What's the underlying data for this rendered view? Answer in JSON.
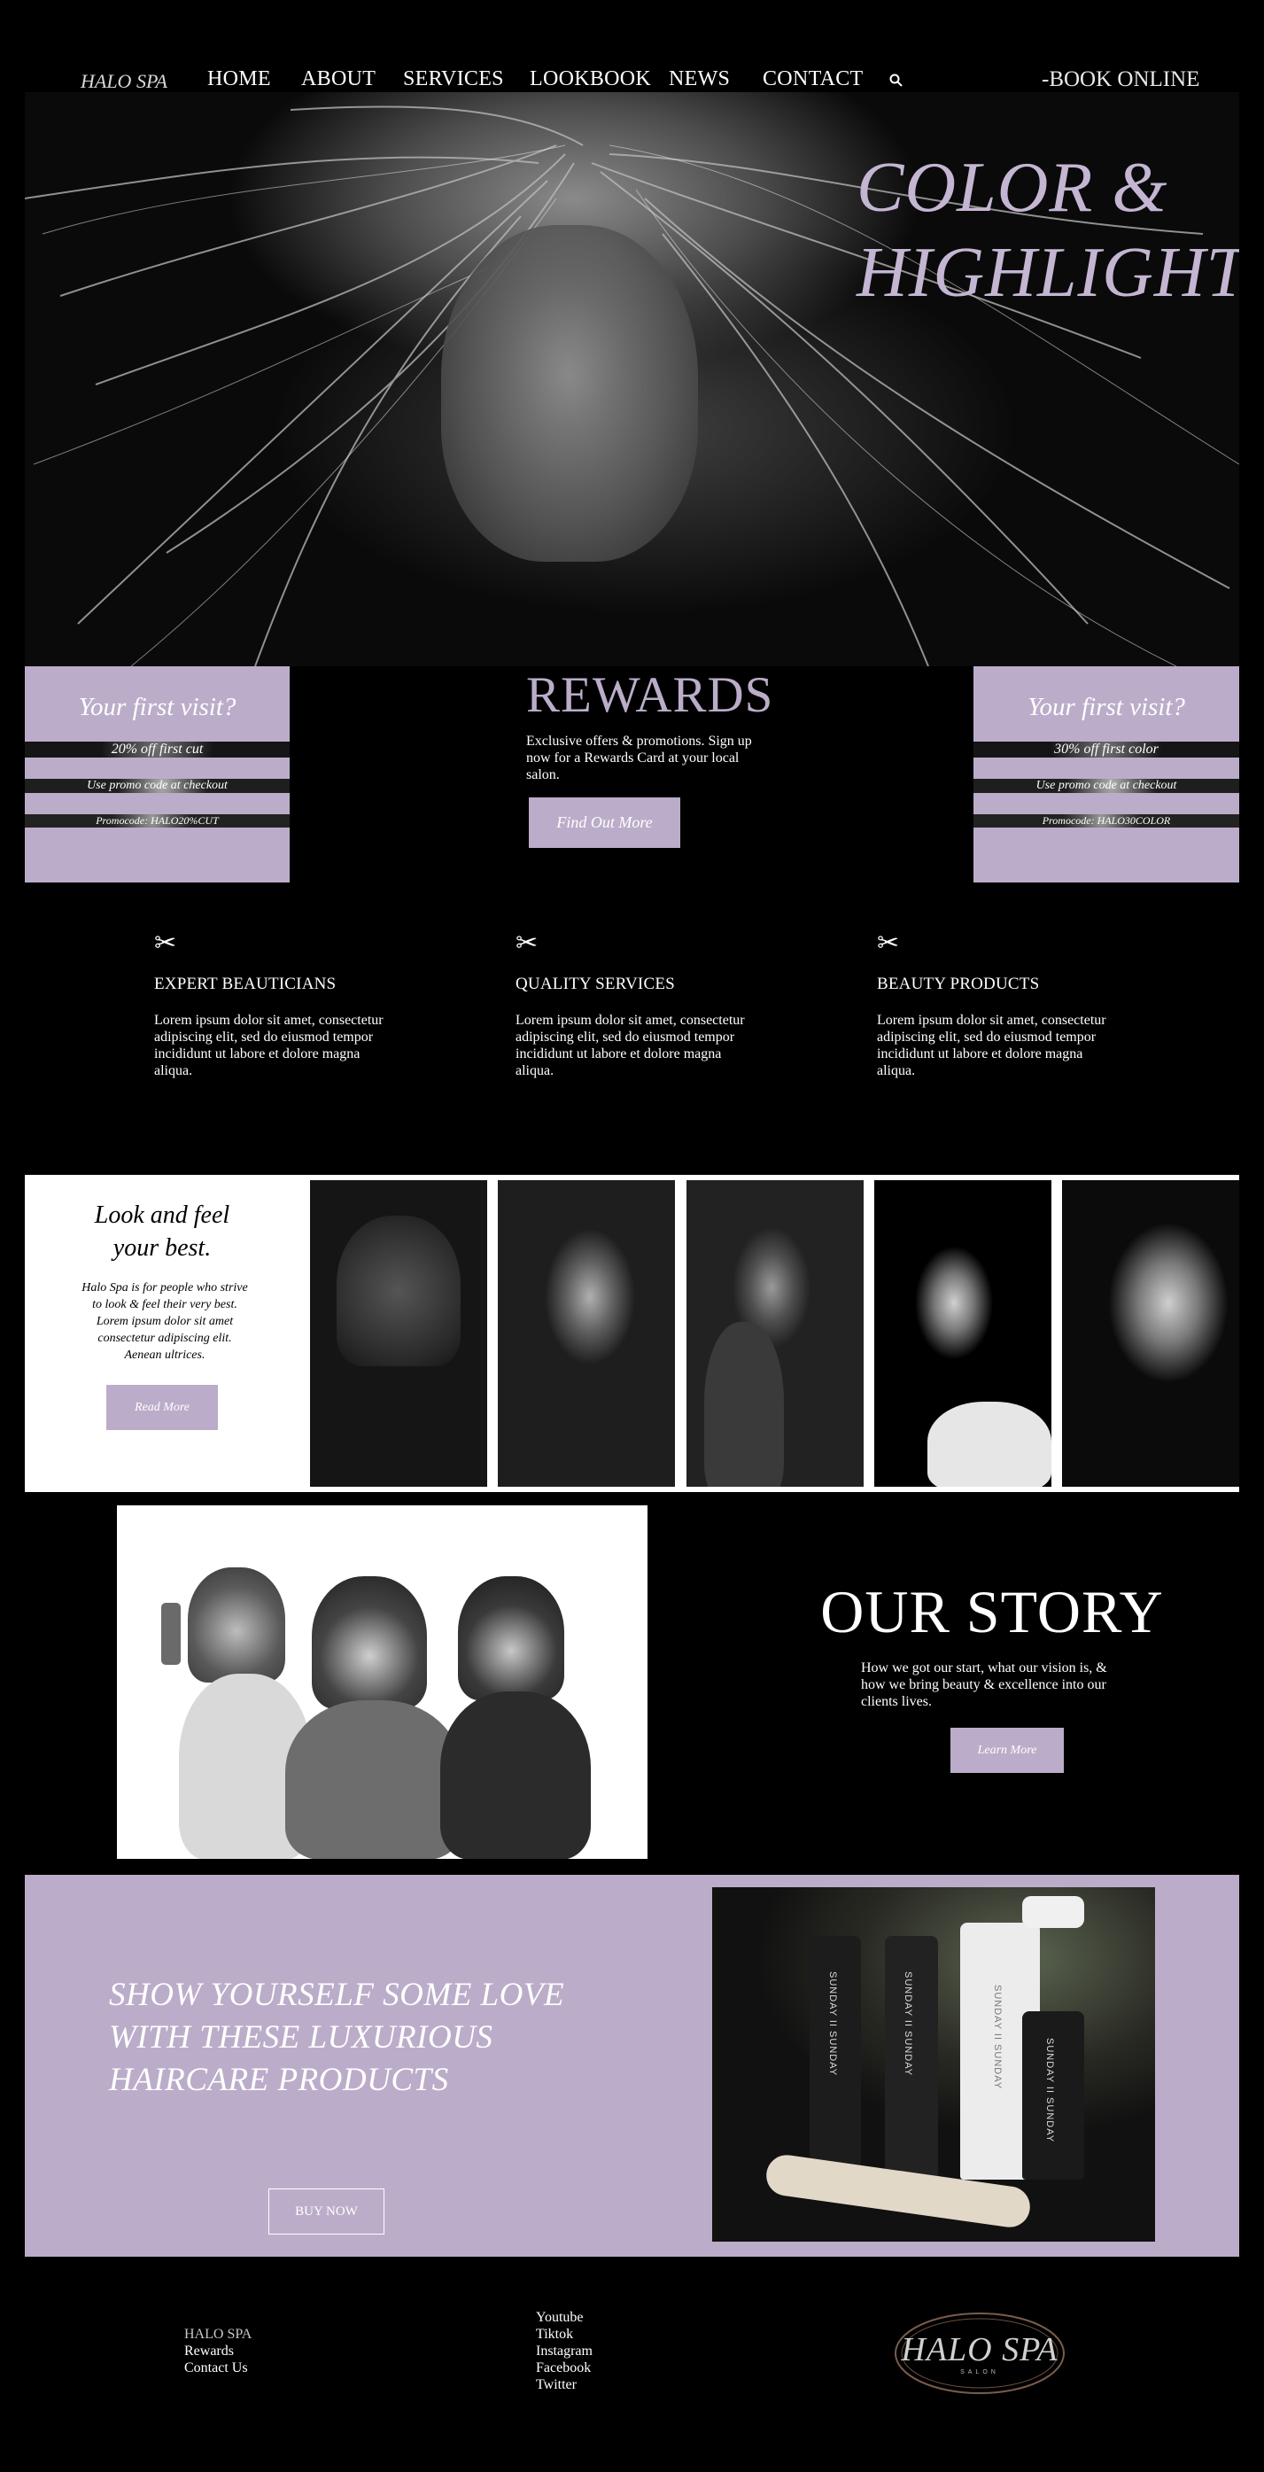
{
  "nav": {
    "logo": "HALO SPA",
    "items": [
      "HOME",
      "ABOUT",
      "SERVICES",
      "LOOKBOOK",
      "NEWS",
      "CONTACT"
    ],
    "book_label": "BOOK ONLINE"
  },
  "hero": {
    "title_line1": "COLOR &",
    "title_line2": "HIGHLIGHTS"
  },
  "promo_left": {
    "heading": "Your first visit?",
    "offer": "20% off first cut",
    "note": "Use promo code at checkout",
    "code": "Promocode: HALO20%CUT"
  },
  "promo_right": {
    "heading": "Your first visit?",
    "offer": "30% off first color",
    "note": "Use promo code at checkout",
    "code": "Promocode: HALO30COLOR"
  },
  "rewards": {
    "heading": "REWARDS",
    "description": "Exclusive offers & promotions. Sign up now for a Rewards Card at your local salon.",
    "button": "Find Out More"
  },
  "features": [
    {
      "icon": "scissors-icon",
      "heading": "EXPERT BEAUTICIANS",
      "text": "Lorem ipsum dolor sit amet, consectetur adipiscing elit, sed do eiusmod tempor incididunt ut labore et dolore magna aliqua."
    },
    {
      "icon": "scissors-icon",
      "heading": "QUALITY SERVICES",
      "text": "Lorem ipsum dolor sit amet, consectetur adipiscing elit, sed do eiusmod tempor incididunt ut labore et dolore magna aliqua."
    },
    {
      "icon": "scissors-icon",
      "heading": "BEAUTY PRODUCTS",
      "text": "Lorem ipsum dolor sit amet, consectetur adipiscing elit, sed do eiusmod tempor incididunt ut labore et dolore magna aliqua."
    }
  ],
  "lookbook": {
    "heading_line1": "Look and feel",
    "heading_line2": "your best.",
    "text": "Halo Spa is for people who strive to look & feel their very best. Lorem ipsum dolor sit amet consectetur adipiscing elit. Aenean ultrices.",
    "button": "Read More"
  },
  "story": {
    "heading": "OUR STORY",
    "text": "How we got our start, what our vision is, & how we bring beauty & excellence into our clients lives.",
    "button": "Learn More"
  },
  "products": {
    "heading_line1": "SHOW YOURSELF SOME LOVE",
    "heading_line2": "WITH THESE LUXURIOUS",
    "heading_line3": "HAIRCARE PRODUCTS",
    "button": "BUY NOW",
    "bottle_brand": "SUNDAY II SUNDAY"
  },
  "footer": {
    "col1": [
      "HALO SPA",
      "Rewards",
      "Contact Us"
    ],
    "col2": [
      "Youtube",
      "Tiktok",
      "Instagram",
      "Facebook",
      "Twitter"
    ],
    "logo_text": "HALO SPA",
    "logo_sub": "SALON"
  },
  "colors": {
    "accent": "#bbadc9",
    "background": "#000000"
  }
}
